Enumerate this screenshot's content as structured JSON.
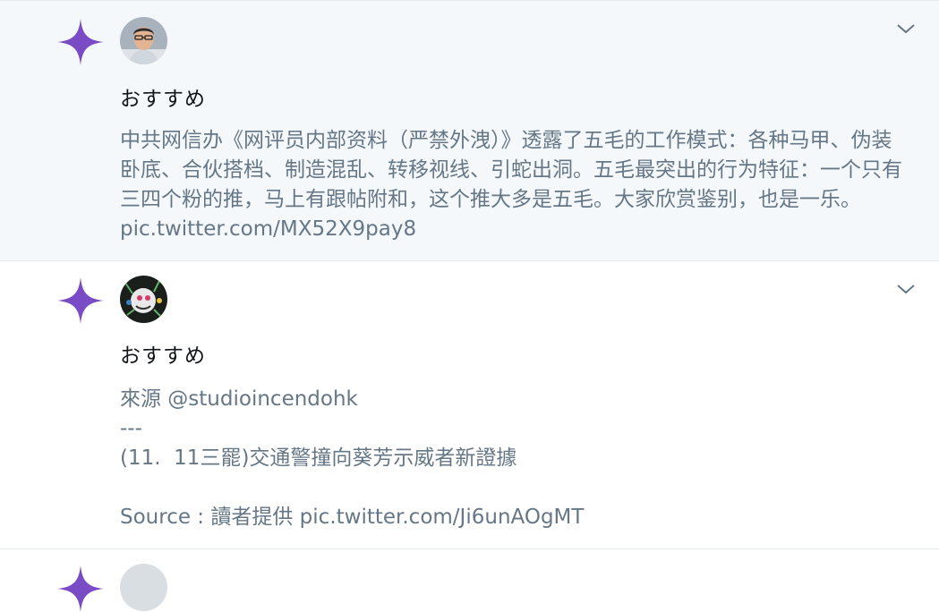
{
  "tweets": [
    {
      "label": "おすすめ",
      "text": "中共网信办《网评员内部资料（严禁外洩）》透露了五毛的工作模式：各种马甲、伪装卧底、合伙搭档、制造混乱、转移视线、引蛇出洞。五毛最突出的行为特征：一个只有三四个粉的推，马上有跟帖附和，这个推大多是五毛。大家欣赏鉴别，也是一乐。 pic.twitter.com/MX52X9pay8",
      "icon": "sparkle-icon",
      "avatar": "user-avatar-photo"
    },
    {
      "label": "おすすめ",
      "text": "來源 @studioincendohk\n---\n(11.  11三罷)交通警撞向葵芳示威者新證據\n\nSource : 讀者提供 pic.twitter.com/Ji6unAOgMT",
      "icon": "sparkle-icon",
      "avatar": "user-avatar-illustration"
    }
  ],
  "colors": {
    "sparkle": "#794bc4",
    "highlight_bg": "#f5f8fa",
    "text_secondary": "#657786",
    "text_primary": "#14171a",
    "divider": "#e6ecf0"
  }
}
